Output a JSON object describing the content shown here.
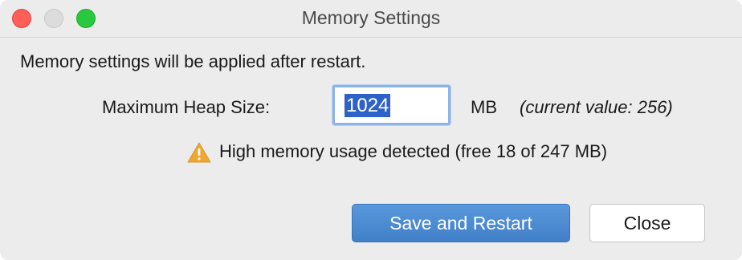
{
  "window": {
    "title": "Memory Settings"
  },
  "dialog": {
    "info_text": "Memory settings will be applied after restart.",
    "heap_label": "Maximum Heap Size:",
    "heap_value": "1024",
    "heap_unit": "MB",
    "current_value": "(current value: 256)",
    "warning_text": "High memory usage detected (free 18 of 247 MB)",
    "warning_icon": "warning-triangle-icon"
  },
  "buttons": {
    "save_restart": "Save and Restart",
    "close": "Close"
  },
  "colors": {
    "primary_button": "#4a8ad4",
    "selection": "#2f62c9",
    "warning": "#f0a732"
  }
}
